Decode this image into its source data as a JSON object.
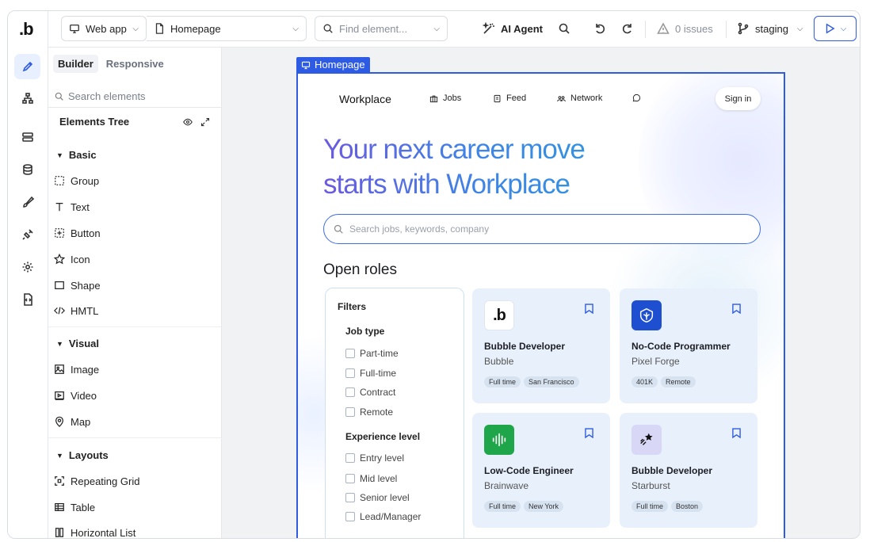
{
  "app": {
    "logo": ".b"
  },
  "topbar": {
    "app_type": "Web app",
    "page": "Homepage",
    "find_placeholder": "Find element...",
    "ai_agent": "AI Agent",
    "issues": "0 issues",
    "branch": "staging"
  },
  "panel": {
    "tabs": [
      "Builder",
      "Responsive"
    ],
    "search_placeholder": "Search elements",
    "tree_title": "Elements Tree",
    "sections": {
      "basic": {
        "title": "Basic",
        "items": [
          "Group",
          "Text",
          "Button",
          "Icon",
          "Shape",
          "HMTL"
        ]
      },
      "visual": {
        "title": "Visual",
        "items": [
          "Image",
          "Video",
          "Map"
        ]
      },
      "layouts": {
        "title": "Layouts",
        "items": [
          "Repeating Grid",
          "Table",
          "Horizontal List"
        ]
      }
    }
  },
  "canvas": {
    "frame_label": "Homepage",
    "site": {
      "logo": "Workplace",
      "nav": [
        "Jobs",
        "Feed",
        "Network"
      ],
      "sign_in": "Sign in",
      "hero_line1": "Your next career move",
      "hero_line2": "starts with Workplace",
      "search_placeholder": "Search jobs, keywords, company",
      "open_roles": "Open roles",
      "filters": {
        "title": "Filters",
        "job_type": "Job type",
        "job_type_options": [
          "Part-time",
          "Full-time",
          "Contract",
          "Remote"
        ],
        "experience": "Experience level",
        "experience_options": [
          "Entry level",
          "Mid level",
          "Senior level",
          "Lead/Manager"
        ]
      },
      "cards": [
        {
          "title": "Bubble Developer",
          "company": "Bubble",
          "tags": [
            "Full time",
            "San Francisco"
          ],
          "logo_bg": "#ffffff"
        },
        {
          "title": "No-Code Programmer",
          "company": "Pixel Forge",
          "tags": [
            "401K",
            "Remote"
          ],
          "logo_bg": "#1f4fd1"
        },
        {
          "title": "Low-Code Engineer",
          "company": "Brainwave",
          "tags": [
            "Full time",
            "New York"
          ],
          "logo_bg": "#1fa64a"
        },
        {
          "title": "Bubble Developer",
          "company": "Starburst",
          "tags": [
            "Full time",
            "Boston"
          ],
          "logo_bg": "#d8d8f6"
        }
      ]
    }
  },
  "colors": {
    "accent": "#2d5be3",
    "card_bg": "#e8f0fb"
  }
}
